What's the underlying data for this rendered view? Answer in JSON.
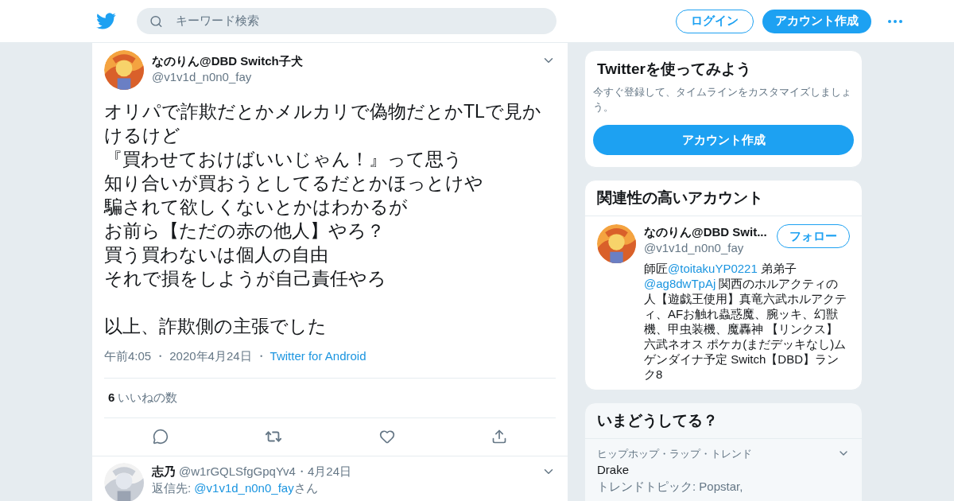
{
  "header": {
    "search": {
      "placeholder": "キーワード検索"
    },
    "login": "ログイン",
    "signup": "アカウント作成"
  },
  "tweet": {
    "name": "なのりん@DBD Switch子犬",
    "handle": "@v1v1d_n0n0_fay",
    "paragraphs": [
      [
        "オリパで詐欺だとかメルカリで偽物だとかTLで見か",
        "けるけど",
        "『買わせておけばいいじゃん！』って思う",
        "知り合いが買おうとしてるだとかほっとけや",
        "騙されて欲しくないとかはわかるが",
        "お前ら【ただの赤の他人】やろ？",
        "買う買わないは個人の自由",
        "それで損をしようが自己責任やろ"
      ],
      [
        "以上、詐欺側の主張でした"
      ]
    ],
    "separator_1": "・",
    "separator_2": "・",
    "time": "午前4:05",
    "date": "2020年4月24日",
    "source": "Twitter for Android",
    "likes_count": "6",
    "likes_label": "いいねの数"
  },
  "reply": {
    "name": "志乃",
    "handle": "@w1rGQLSfgGpqYv4",
    "separator": "・",
    "date": "4月24日",
    "reply_to": [
      {
        "kind": "text",
        "text": "返信先: "
      },
      {
        "kind": "link",
        "text": "@v1v1d_n0n0_fay"
      },
      {
        "kind": "text",
        "text": "さん"
      }
    ]
  },
  "signup_card": {
    "title": "Twitterを使ってみよう",
    "text": "今すぐ登録して、タイムラインをカスタマイズしましょう。",
    "button": "アカウント作成"
  },
  "related": {
    "title": "関連性の高いアカウント",
    "name": "なのりん@DBD Swit...",
    "handle": "@v1v1d_n0n0_fay",
    "follow": "フォロー",
    "bio": [
      {
        "kind": "text",
        "text": "師匠"
      },
      {
        "kind": "link",
        "text": "@toitakuYP0221"
      },
      {
        "kind": "text",
        "text": " 弟弟子 "
      },
      {
        "kind": "link",
        "text": "@ag8dwTpAj"
      },
      {
        "kind": "text",
        "text": " 関西のホルアクティの人【遊戯王使用】真竜六武ホルアクティ、AFお触れ蟲惑魔、腕ッキ、幻獣機、甲虫装機、魔轟神 【リンクス】六武ネオス ポケカ(まだデッキなし)ムゲンダイナ予定 Switch【DBD】ランク8"
      }
    ]
  },
  "trends": {
    "title": "いまどうしてる？",
    "items": [
      {
        "category": "ヒップホップ・ラップ・トレンド",
        "name": "Drake",
        "topic": "トレンドトピック: Popstar,"
      }
    ]
  }
}
